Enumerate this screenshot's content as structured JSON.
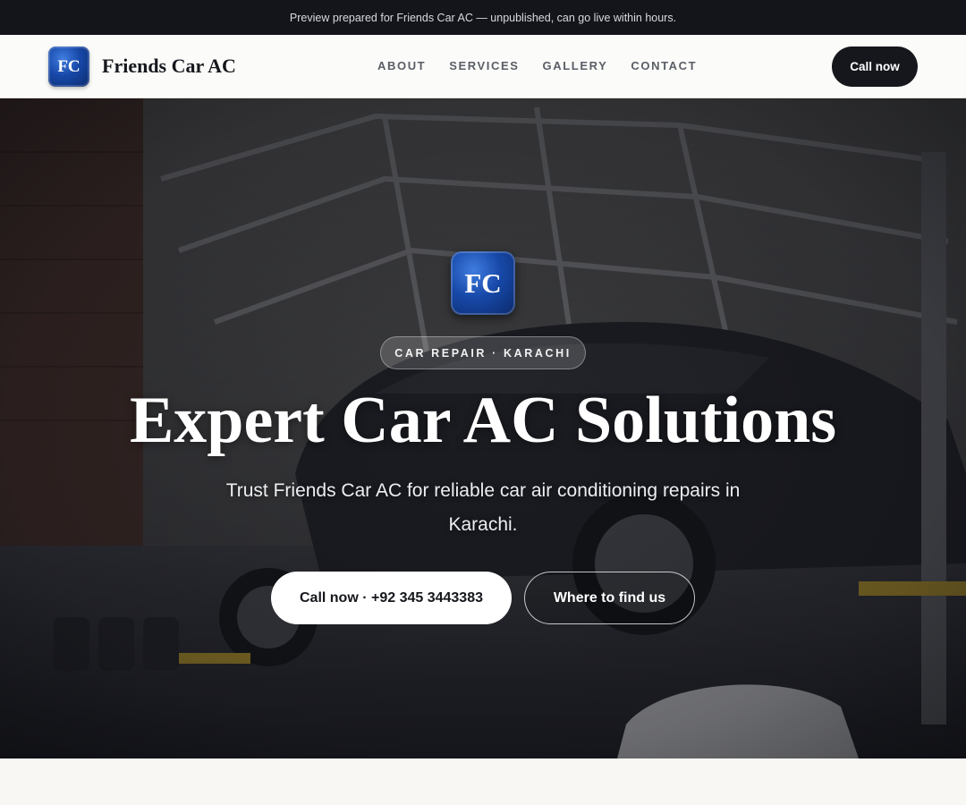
{
  "banner": {
    "text": "Preview prepared for Friends Car AC — unpublished, can go live within hours."
  },
  "nav": {
    "logo_initials": "FC",
    "brand_name": "Friends Car AC",
    "links": [
      {
        "label": "ABOUT"
      },
      {
        "label": "SERVICES"
      },
      {
        "label": "GALLERY"
      },
      {
        "label": "CONTACT"
      }
    ],
    "cta_label": "Call now"
  },
  "hero": {
    "logo_initials": "FC",
    "kicker": "CAR REPAIR · KARACHI",
    "headline": "Expert Car AC Solutions",
    "subheadline": "Trust Friends Car AC for reliable car air conditioning repairs in Karachi.",
    "primary_button": "Call now · +92 345 3443383",
    "secondary_button": "Where to find us",
    "background_image": "car-workshop-photo"
  },
  "colors": {
    "banner_bg": "#13151b",
    "nav_bg": "#fbfbf9",
    "primary_dark": "#15171c",
    "logo_blue": "#1748a8",
    "page_bg": "#f8f7f4"
  }
}
